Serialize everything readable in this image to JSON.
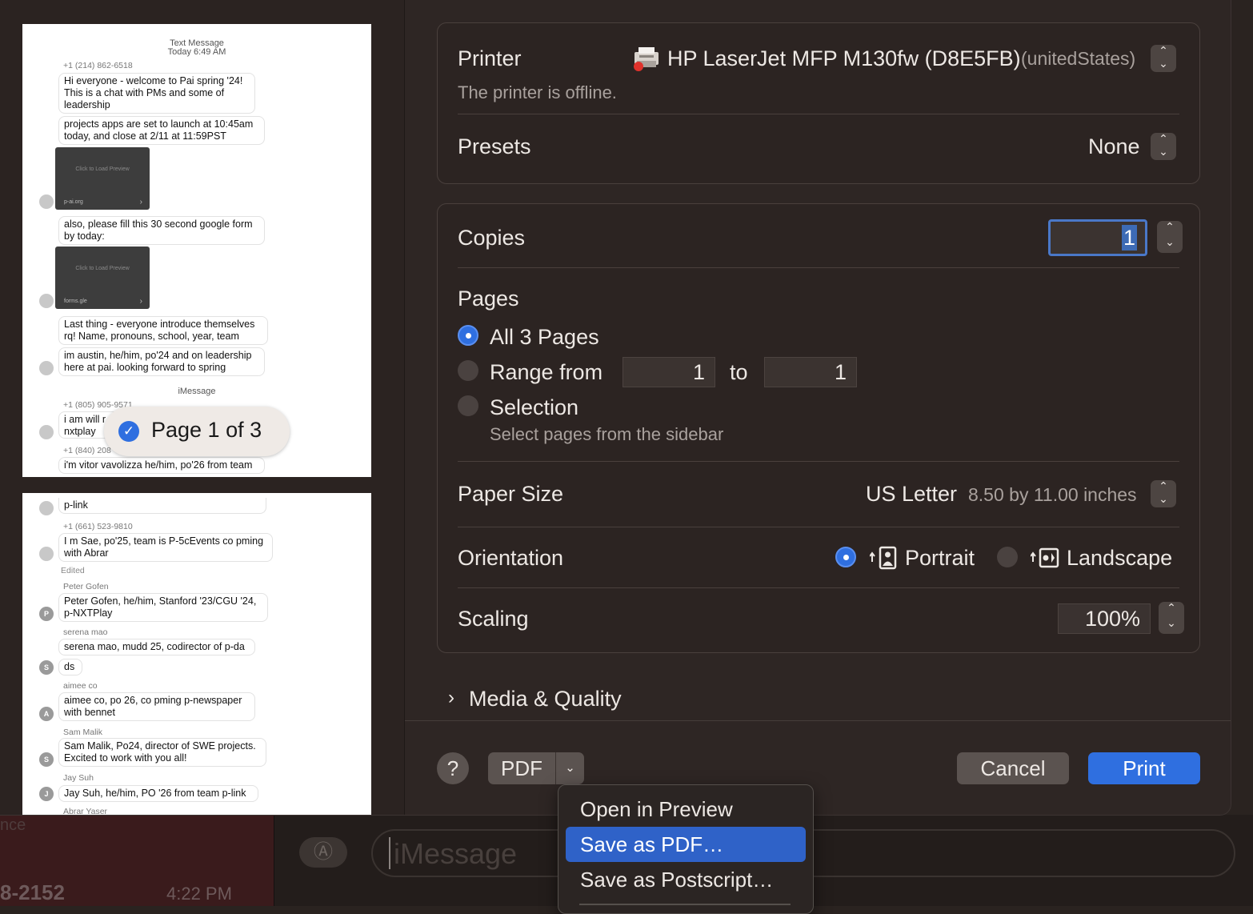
{
  "background": {
    "contact_number": "8-2152",
    "contact_time": "4:22 PM",
    "faint_text": "nce",
    "imessage_placeholder": "iMessage"
  },
  "preview": {
    "page1": {
      "header_title": "Text Message",
      "header_time": "Today 6:49 AM",
      "sender1": "+1 (214) 862-6518",
      "msg1": "Hi everyone - welcome to Pai spring '24! This is a chat with PMs and some of leadership",
      "msg2": "projects apps are set to launch at 10:45am today, and close at 2/11 at 11:59PST",
      "card1_text": "Click to Load Preview",
      "card1_domain": "p-ai.org",
      "msg3": "also, please fill this 30 second google form by today:",
      "card2_text": "Click to Load Preview",
      "card2_domain": "forms.gle",
      "msg4": "Last thing - everyone introduce themselves rq! Name, pronouns, school, year, team",
      "msg5": "im austin, he/him, po'24 and on leadership here at pai. looking forward to spring",
      "service_label": "iMessage",
      "sender2": "+1 (805) 905-9571",
      "msg6": "i am will r",
      "msg6b": "nxtplay",
      "sender3": "+1 (840) 208",
      "msg7": "i'm vitor vavolizza he/him, po'26 from team"
    },
    "page2": {
      "msg1": "p-link",
      "sender1": "+1 (661) 523-9810",
      "msg2": "I m Sae, po'25, team is P-5cEvents co pming with Abrar",
      "edited": "Edited",
      "sender2": "Peter Gofen",
      "avatar2": "P",
      "msg3": "Peter Gofen, he/him, Stanford '23/CGU '24, p-NXTPlay",
      "sender3": "serena mao",
      "avatar3": "S",
      "msg4": "serena mao, mudd 25, codirector of p-da",
      "msg4b": "ds",
      "sender4": "aimee co",
      "avatar4": "A",
      "msg5": "aimee co, po 26, co pming p-newspaper with bennet",
      "sender5": "Sam Malik",
      "avatar5": "S",
      "msg6": "Sam Malik, Po24, director of SWE projects. Excited to work with you all!",
      "sender6": "Jay Suh",
      "avatar6": "J",
      "msg7": "Jay Suh, he/him, PO '26 from team p-link",
      "sender7": "Abrar Yaser"
    },
    "page_badge": "Page 1 of 3"
  },
  "settings": {
    "printer_label": "Printer",
    "printer_name": "HP LaserJet MFP M130fw (D8E5FB)",
    "printer_location": "(unitedStates)",
    "printer_status": "The printer is offline.",
    "presets_label": "Presets",
    "presets_value": "None",
    "copies_label": "Copies",
    "copies_value": "1",
    "pages_label": "Pages",
    "pages_all": "All 3 Pages",
    "pages_range": "Range from",
    "range_from": "1",
    "range_to_label": "to",
    "range_to": "1",
    "pages_selection": "Selection",
    "pages_selection_hint": "Select pages from the sidebar",
    "paper_label": "Paper Size",
    "paper_value": "US Letter",
    "paper_dims": "8.50 by 11.00 inches",
    "orientation_label": "Orientation",
    "orientation_portrait": "Portrait",
    "orientation_landscape": "Landscape",
    "scaling_label": "Scaling",
    "scaling_value": "100%",
    "media_quality": "Media & Quality"
  },
  "buttons": {
    "help": "?",
    "pdf": "PDF",
    "cancel": "Cancel",
    "print": "Print"
  },
  "pdf_menu": {
    "items": [
      "Open in Preview",
      "Save as PDF…",
      "Save as Postscript…"
    ],
    "highlighted": "Save as PDF…"
  },
  "colors": {
    "accent": "#2f6fe0",
    "panel": "#2e2624"
  }
}
